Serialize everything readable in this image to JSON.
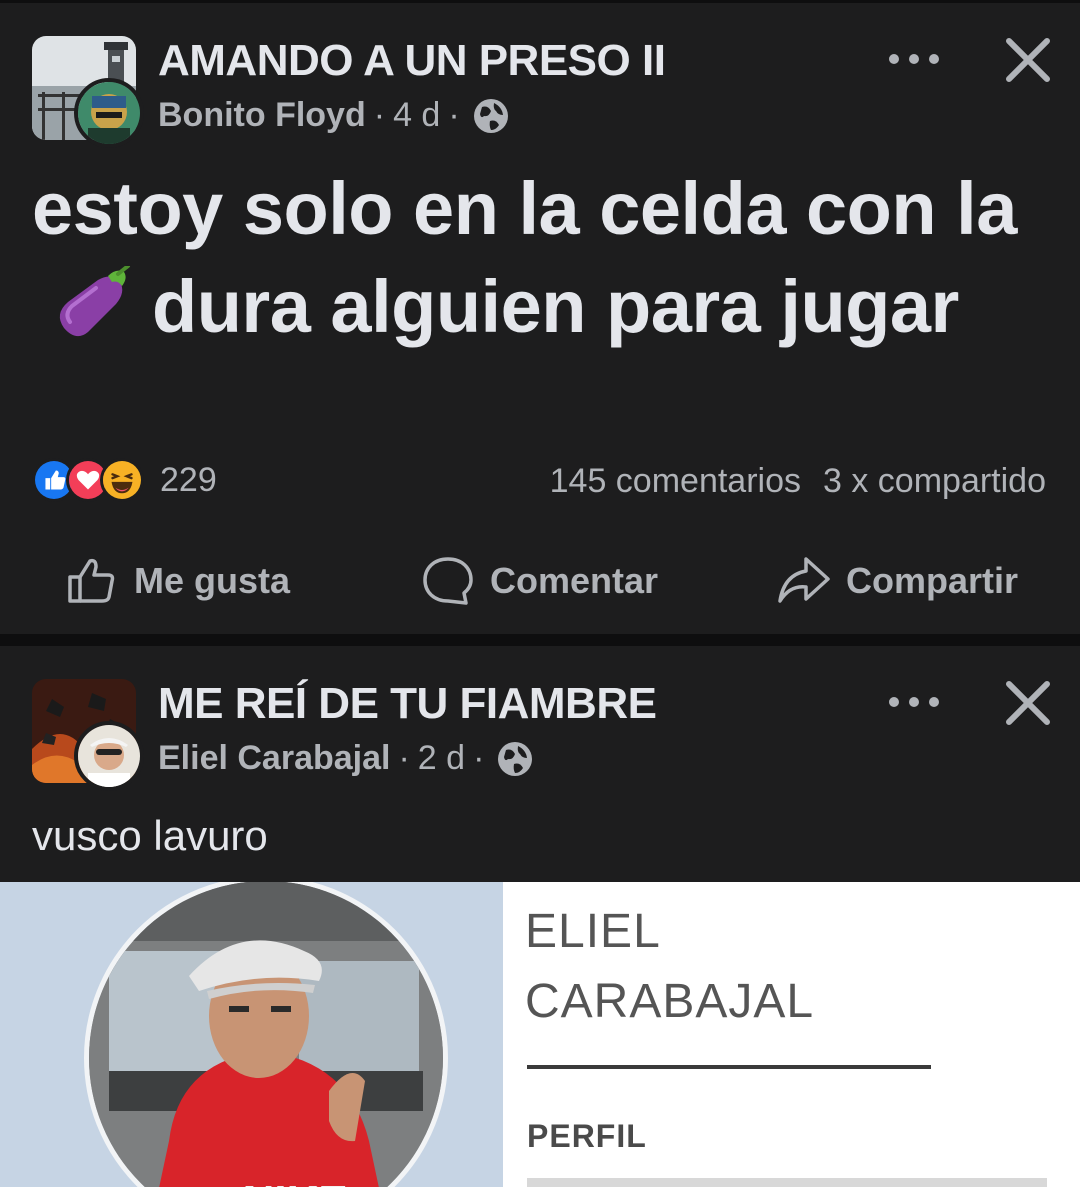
{
  "posts": [
    {
      "group_name": "AMANDO A UN PRESO II",
      "author": "Bonito Floyd",
      "time": "4 d",
      "separator": "·",
      "audience_icon": "globe-icon",
      "text_before": "estoy solo en la celda con la",
      "emoji": "eggplant-emoji",
      "text_after": "dura alguien para jugar",
      "reaction_icons": [
        "like-reaction-icon",
        "love-reaction-icon",
        "haha-reaction-icon"
      ],
      "reaction_count": "229",
      "comments": "145 comentarios",
      "shares": "3 x compartido",
      "actions": {
        "like": "Me gusta",
        "comment": "Comentar",
        "share": "Compartir"
      }
    },
    {
      "group_name": "ME REÍ DE TU FIAMBRE",
      "author": "Eliel Carabajal",
      "time": "2 d",
      "separator": "·",
      "audience_icon": "globe-icon",
      "caption": "vusco lavuro",
      "shared_image": {
        "name_line1": "ELIEL",
        "name_line2": "CARABAJAL",
        "label": "PERFIL",
        "shirt_text": "NIKE"
      }
    }
  ],
  "colors": {
    "background": "#0e0e0f",
    "card": "#1d1d1e",
    "primary_text": "#e4e6eb",
    "secondary_text": "#b0b3b8",
    "like_blue": "#1877f2",
    "love_red": "#f33e58",
    "haha_yellow": "#f7b125"
  }
}
